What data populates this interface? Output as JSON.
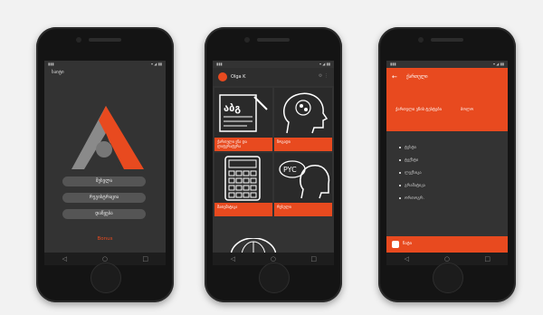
{
  "accent": "#e84a1f",
  "phone1": {
    "status_left": "▮▮▮",
    "status_right": "▾ ◢ ▮▮",
    "top_label": "საიტი",
    "buttons": [
      "შესვლა",
      "რეგისტრაცია",
      "დაწყება"
    ],
    "red_label": "Bonus"
  },
  "phone2": {
    "status_left": "▮▮▮",
    "status_right": "▾ ◢ ▮▮",
    "user_name": "Olga K",
    "header_icons": "⚙  ⋮",
    "tiles": [
      {
        "icon": "book-alphabet-icon",
        "glyph": "აბგ",
        "label": "ქართული ენა და ლიტერატურა"
      },
      {
        "icon": "head-brain-icon",
        "glyph": "",
        "label": "ზოგადი"
      },
      {
        "icon": "calculator-icon",
        "glyph": "",
        "label": "მათემატიკა"
      },
      {
        "icon": "head-speech-icon",
        "glyph": "PYC",
        "label": "რუსული"
      }
    ]
  },
  "phone3": {
    "status_left": "▮▮▮",
    "status_right": "▾ ◢ ▮▮",
    "back_icon": "←",
    "title": "ქართული",
    "subtitle_left": "ქართული ენის ტესტები",
    "subtitle_right": "ბოლო",
    "items": [
      "ტესტი",
      "ტექსტი",
      "ლექსიკა",
      "გრამატიკა",
      "ორთოგრ."
    ],
    "footer_label": "ჩატი"
  },
  "nav": [
    "◁",
    "○",
    "□"
  ]
}
